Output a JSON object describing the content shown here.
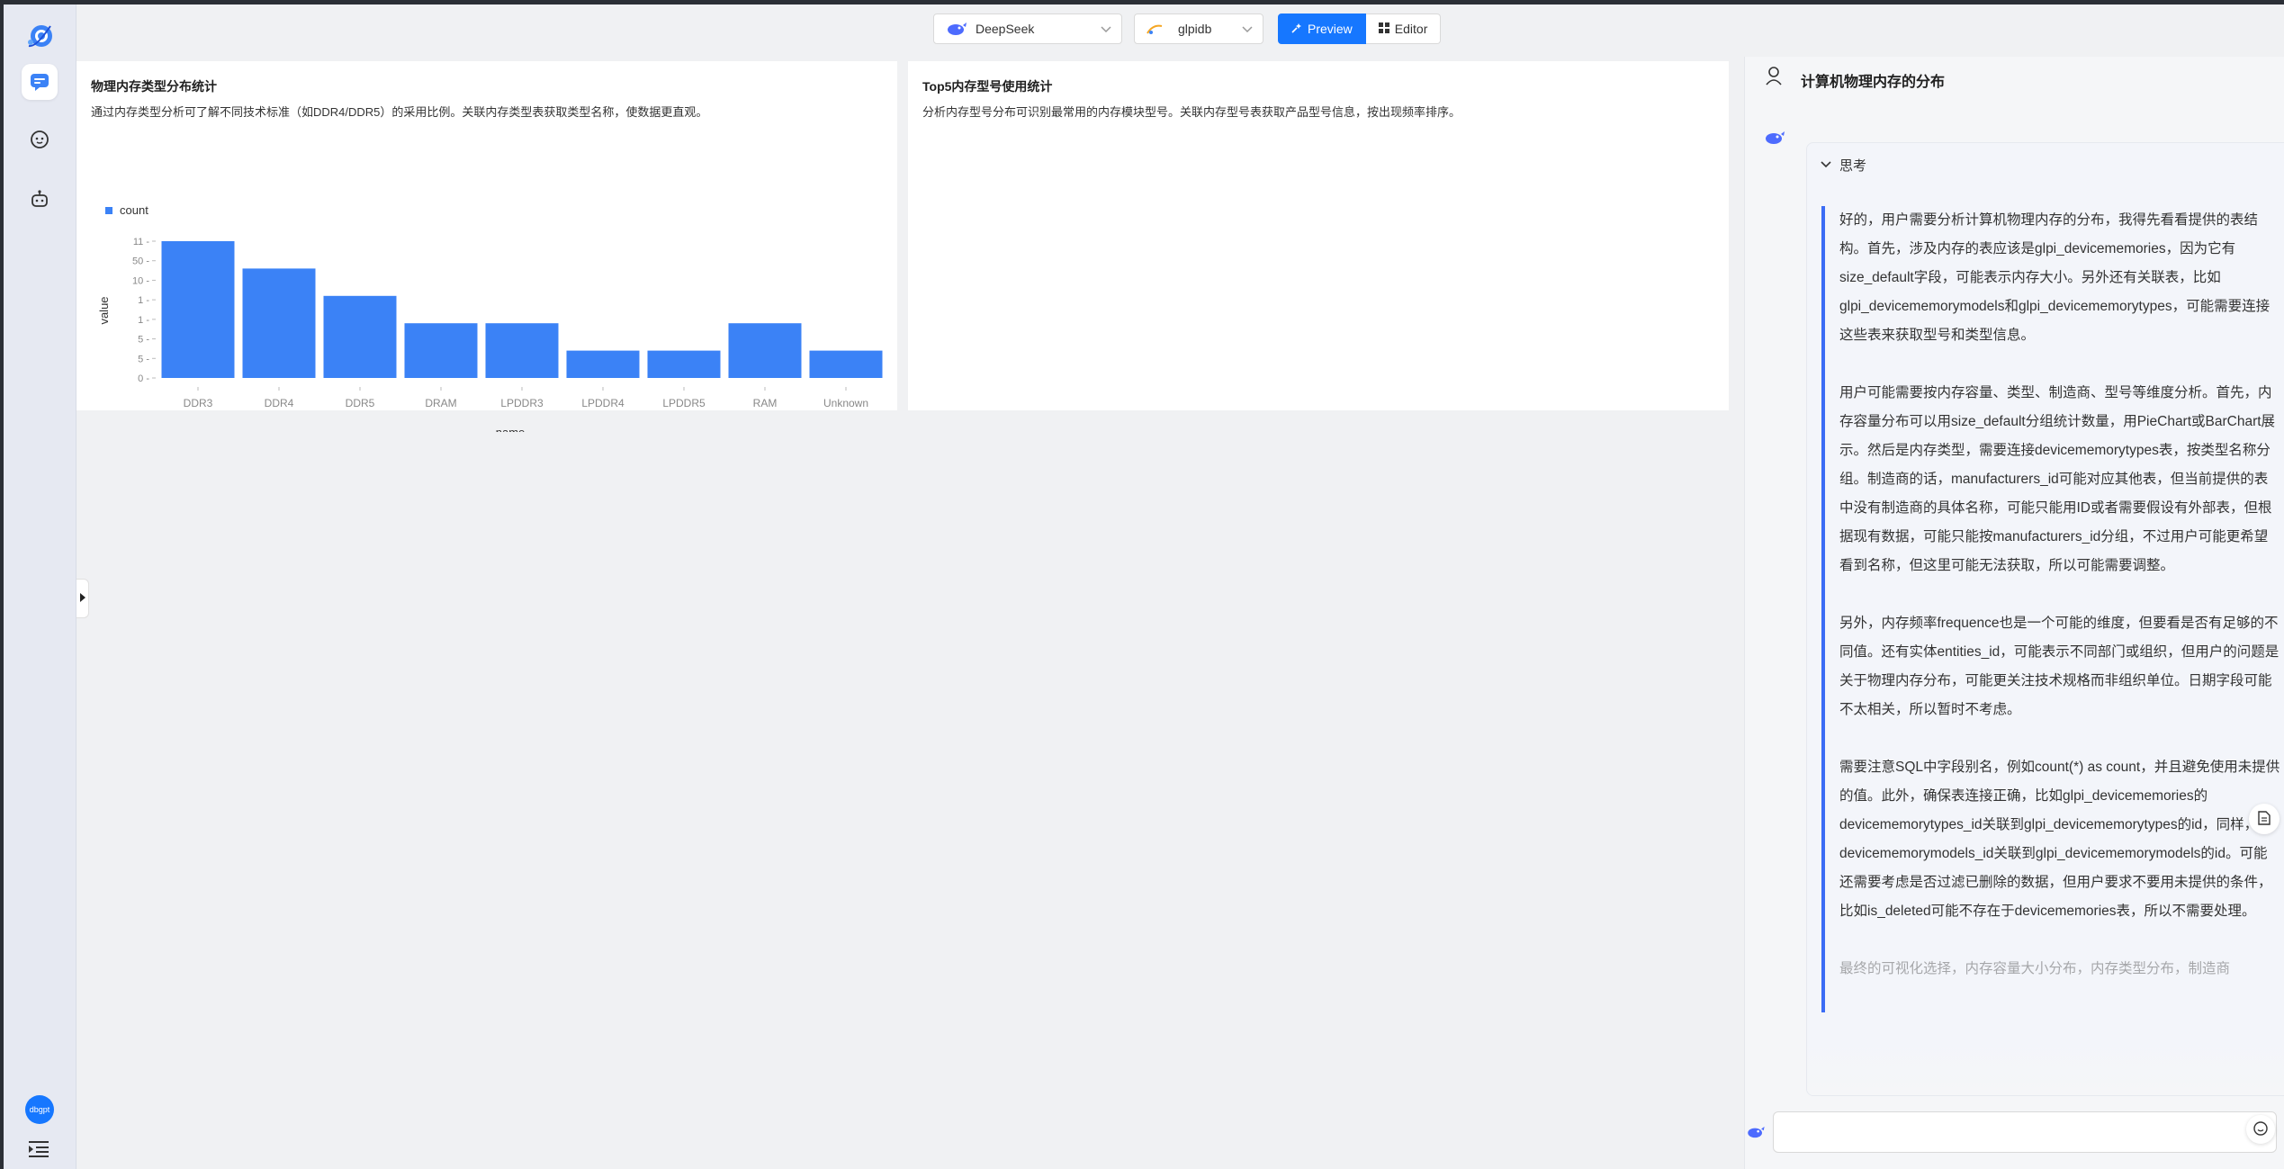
{
  "top_selectors": {
    "model": "DeepSeek",
    "database": "glpidb"
  },
  "view_toggle": {
    "preview_label": "Preview",
    "editor_label": "Editor"
  },
  "sidebar": {
    "user_avatar_label": "dbgpt",
    "items": [
      "app-logo",
      "chat",
      "explore",
      "agent"
    ]
  },
  "cards": [
    {
      "title": "物理内存类型分布统计",
      "description": "通过内存类型分析可了解不同技术标准（如DDR4/DDR5）的采用比例。关联内存类型表获取类型名称，使数据更直观。"
    },
    {
      "title": "Top5内存型号使用统计",
      "description": "分析内存型号分布可识别最常用的内存模块型号。关联内存型号表获取产品型号信息，按出现频率排序。"
    }
  ],
  "chart_data": {
    "type": "bar",
    "categories": [
      "DDR3",
      "DDR4",
      "DDR5",
      "DRAM",
      "LPDDR3",
      "LPDDR4",
      "LPDDR5",
      "RAM",
      "Unknown"
    ],
    "series": [
      {
        "name": "count",
        "values": [
          11,
          50,
          10,
          1,
          1,
          5,
          5,
          1,
          5
        ],
        "color": "#3b82f6"
      }
    ],
    "y_ticks": [
      "11",
      "50",
      "10",
      "1",
      "1",
      "5",
      "5",
      "0"
    ],
    "bar_heights_relative": [
      1.0,
      0.8,
      0.6,
      0.4,
      0.4,
      0.2,
      0.2,
      0.4,
      0.2
    ],
    "xlabel": "name",
    "ylabel": "value",
    "legend": "top-left"
  },
  "chat": {
    "title": "计算机物理内存的分布",
    "thinking_label": "思考",
    "thinking_paragraphs": [
      "好的，用户需要分析计算机物理内存的分布，我得先看看提供的表结构。首先，涉及内存的表应该是glpi_devicememories，因为它有size_default字段，可能表示内存大小。另外还有关联表，比如glpi_devicememorymodels和glpi_devicememorytypes，可能需要连接这些表来获取型号和类型信息。",
      "用户可能需要按内存容量、类型、制造商、型号等维度分析。首先，内存容量分布可以用size_default分组统计数量，用PieChart或BarChart展示。然后是内存类型，需要连接devicememorytypes表，按类型名称分组。制造商的话，manufacturers_id可能对应其他表，但当前提供的表中没有制造商的具体名称，可能只能用ID或者需要假设有外部表，但根据现有数据，可能只能按manufacturers_id分组，不过用户可能更希望看到名称，但这里可能无法获取，所以可能需要调整。",
      "另外，内存频率frequence也是一个可能的维度，但要看是否有足够的不同值。还有实体entities_id，可能表示不同部门或组织，但用户的问题是关于物理内存分布，可能更关注技术规格而非组织单位。日期字段可能不太相关，所以暂时不考虑。",
      "需要注意SQL中字段别名，例如count(*) as count，并且避免使用未提供的值。此外，确保表连接正确，比如glpi_devicememories的devicememorytypes_id关联到glpi_devicememorytypes的id，同样，devicememorymodels_id关联到glpi_devicememorymodels的id。可能还需要考虑是否过滤已删除的数据，但用户要求不要用未提供的条件，比如is_deleted可能不存在于devicememories表，所以不需要处理。",
      "最终的可视化选择，内存容量大小分布，内存类型分布，制造商"
    ],
    "input_placeholder": ""
  },
  "colors": {
    "accent": "#1677ff",
    "bar": "#3b82f6",
    "thinking_border": "#3b6cf5"
  }
}
